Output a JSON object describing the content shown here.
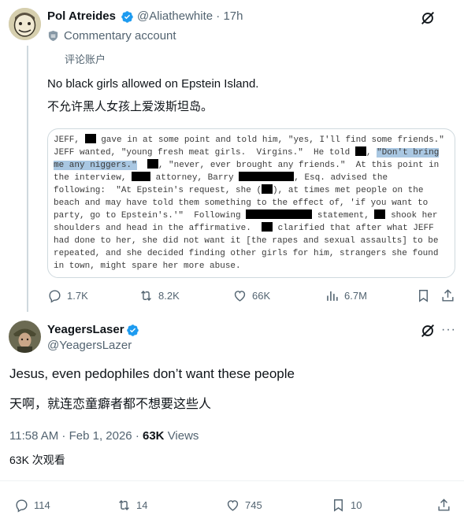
{
  "tweet1": {
    "author_name": "Pol Atreides",
    "handle": "@Aliathewhite",
    "separator": "·",
    "time": "17h",
    "commentary_label": "Commentary account",
    "commentary_label_translated": "评论账户",
    "text": "No black girls allowed on Epstein Island.",
    "text_translated": "不允许黑人女孩上爱泼斯坦岛。",
    "doc_lines": [
      [
        "JEFF, ",
        "[R14]",
        " gave in at some point and told him, \"yes, I'll find some friends.\""
      ],
      [
        "JEFF wanted, \"young fresh meat girls.  Virgins.\"  He told ",
        "[R14]",
        ", ",
        "[HL]\"Don't bring"
      ],
      [
        "[HL]me any niggers.\"",
        "  ",
        "[R14]",
        ", \"never, ever brought any friends.\"  At this point in"
      ],
      [
        "the interview, ",
        "[R24]",
        " attorney, Barry ",
        "[R70]",
        ", Esq. advised the"
      ],
      [
        "following:  \"At Epstein's request, she (",
        "[R14]",
        "), at times met people on the"
      ],
      [
        "beach and may have told them something to the effect of, 'if you want to"
      ],
      [
        "party, go to Epstein's.'\"  Following ",
        "[R84]",
        " statement, ",
        "[R14]",
        " shook her"
      ],
      [
        "shoulders and head in the affirmative.  ",
        "[R14]",
        " clarified that after what JEFF"
      ],
      [
        "had done to her, she did not want it [the rapes and sexual assaults] to be"
      ],
      [
        "repeated, and she decided finding other girls for him, strangers she found"
      ],
      [
        "in town, might spare her more abuse."
      ]
    ],
    "stats": {
      "replies": "1.7K",
      "reposts": "8.2K",
      "likes": "66K",
      "views": "6.7M"
    }
  },
  "tweet2": {
    "author_name": "YeagersLaser",
    "handle": "@YeagersLazer",
    "text": "Jesus, even pedophiles don’t want these people",
    "text_translated": "天啊，就连恋童癖者都不想要这些人",
    "timestamp": "11:58 AM · Feb 1, 2026 · ",
    "views_count": "63K",
    "views_label": "Views",
    "views_translated": "63K 次观看",
    "stats": {
      "replies": "114",
      "reposts": "14",
      "likes": "745",
      "bookmarks": "10"
    }
  },
  "icons": {
    "verified": "verified-badge-icon",
    "grok": "grok-icon",
    "commentary": "commentary-shield-icon"
  },
  "colors": {
    "verified": "#1d9bf0",
    "secondary_text": "#536471",
    "highlight": "#a9c7e2"
  }
}
